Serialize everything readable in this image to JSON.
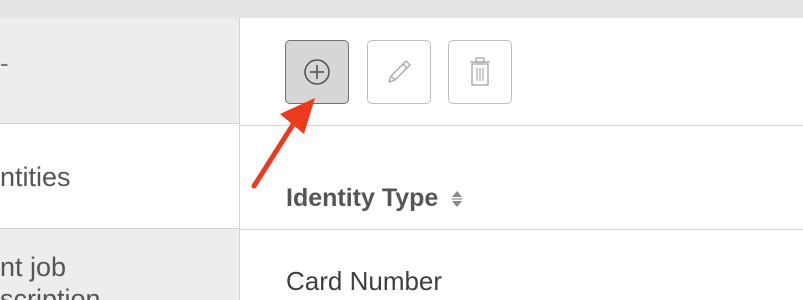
{
  "left_column": {
    "row1_text": "-",
    "row2_text": "ntities",
    "row3_text": "nt job\nscription"
  },
  "toolbar": {
    "add_icon": "plus-circle-icon",
    "edit_icon": "pencil-icon",
    "delete_icon": "trash-icon"
  },
  "table": {
    "column_header": "Identity Type",
    "sort_icon": "sort-arrows-icon",
    "rows": [
      {
        "identity_type": "Card Number"
      }
    ]
  },
  "colors": {
    "annotation_arrow": "#ee3a1c",
    "add_button_bg": "#d6d6d6",
    "row_highlight": "#ededed"
  }
}
